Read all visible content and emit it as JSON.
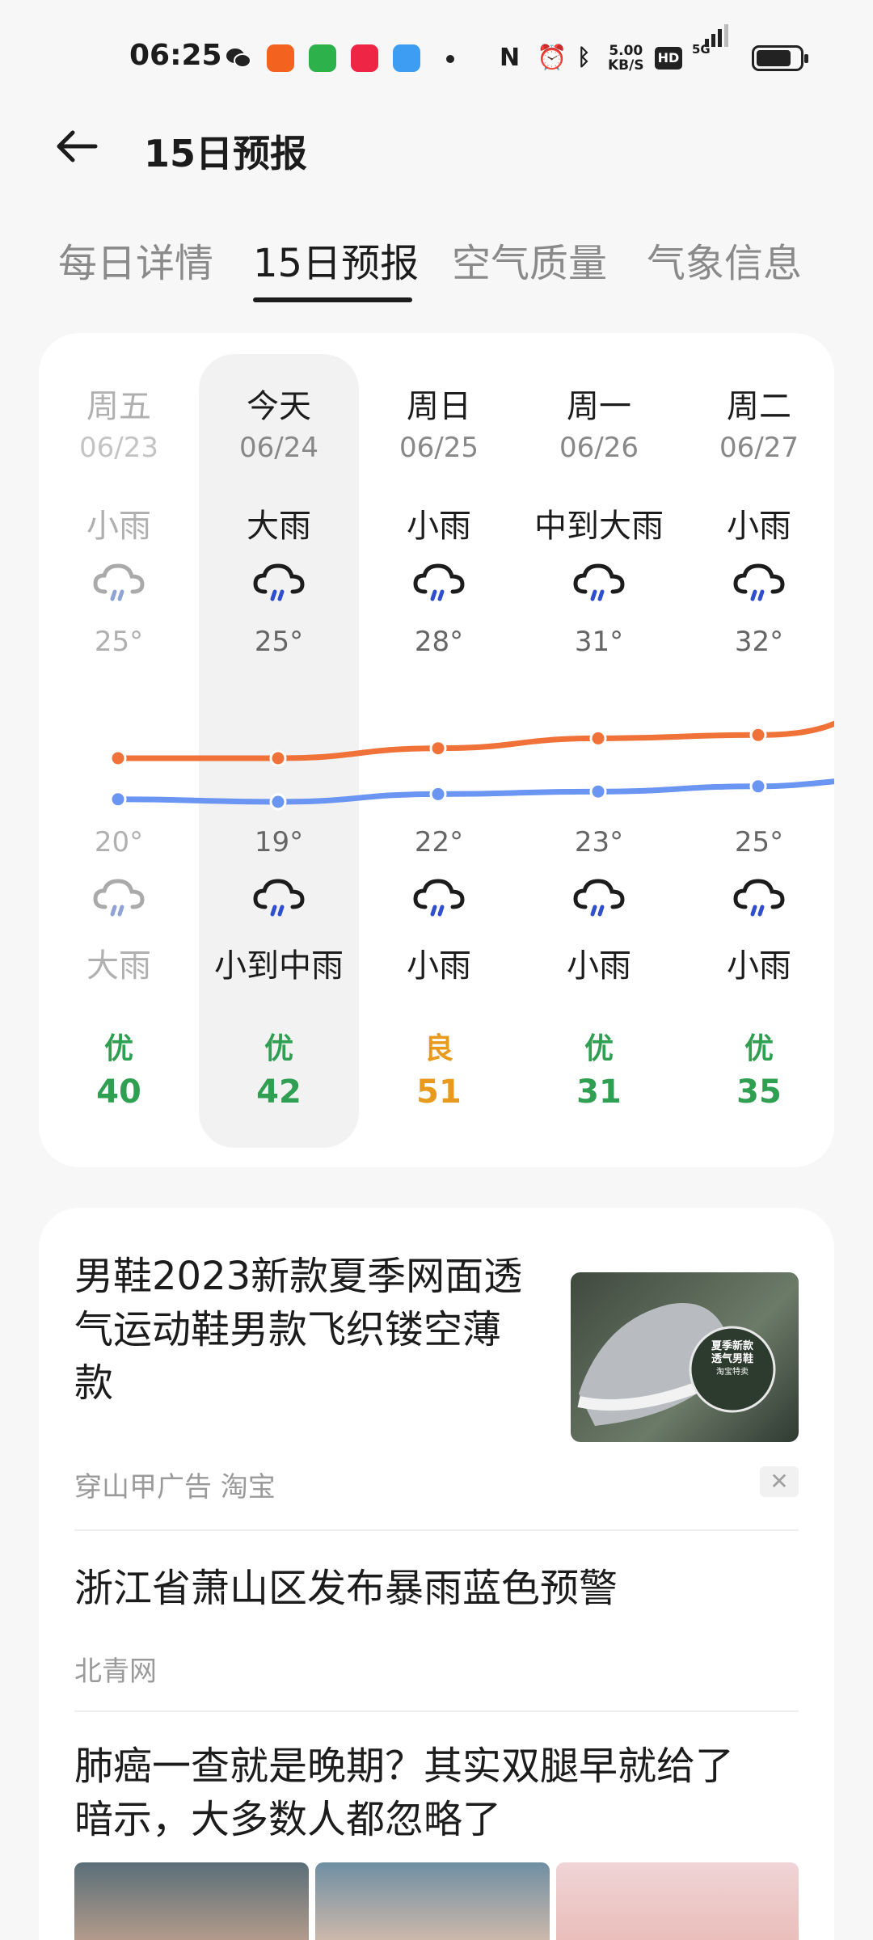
{
  "status_bar": {
    "time": "06:25",
    "net_speed_value": "5.00",
    "net_speed_unit": "KB/S",
    "hd": "HD",
    "network": "5G",
    "icons": [
      "wechat-icon",
      "kuaishou-icon",
      "wechat-mini-icon",
      "xiaohongshu-icon",
      "weather-icon",
      "nfc-icon",
      "alarm-icon",
      "bluetooth-icon",
      "signal-icon",
      "battery-icon"
    ]
  },
  "header": {
    "title": "15日预报"
  },
  "tabs": [
    {
      "label": "每日详情",
      "active": false
    },
    {
      "label": "15日预报",
      "active": true
    },
    {
      "label": "空气质量",
      "active": false
    },
    {
      "label": "气象信息",
      "active": false
    }
  ],
  "forecast": {
    "days": [
      {
        "day": "周五",
        "date": "06/23",
        "day_cond": "小雨",
        "high": "25°",
        "low": "20°",
        "night_cond": "大雨",
        "aqi_level": "优",
        "aqi": "40",
        "past": true
      },
      {
        "day": "今天",
        "date": "06/24",
        "day_cond": "大雨",
        "high": "25°",
        "low": "19°",
        "night_cond": "小到中雨",
        "aqi_level": "优",
        "aqi": "42",
        "today": true
      },
      {
        "day": "周日",
        "date": "06/25",
        "day_cond": "小雨",
        "high": "28°",
        "low": "22°",
        "night_cond": "小雨",
        "aqi_level": "良",
        "aqi": "51"
      },
      {
        "day": "周一",
        "date": "06/26",
        "day_cond": "中到大雨",
        "high": "31°",
        "low": "23°",
        "night_cond": "小雨",
        "aqi_level": "优",
        "aqi": "31"
      },
      {
        "day": "周二",
        "date": "06/27",
        "day_cond": "小雨",
        "high": "32°",
        "low": "25°",
        "night_cond": "小雨",
        "aqi_level": "优",
        "aqi": "35"
      }
    ],
    "colors": {
      "high_line": "#f07238",
      "low_line": "#6b95f2",
      "aqi_good": "#2f9f52",
      "aqi_moderate": "#e89a1d"
    },
    "weather_icon": "rain-cloud-icon"
  },
  "news": [
    {
      "title_lines": [
        "男鞋2023新款夏季网面透",
        "气运动鞋男款飞织镂空薄",
        "款"
      ],
      "source": "穿山甲广告  淘宝",
      "ad": true,
      "image_text": [
        "夏季新款",
        "透气男鞋",
        "淘宝特卖"
      ]
    },
    {
      "title_lines": [
        "浙江省萧山区发布暴雨蓝色预警"
      ],
      "source": "北青网"
    },
    {
      "title_lines": [
        "肺癌一查就是晚期？其实双腿早就给了",
        "暗示，大多数人都忽略了"
      ]
    }
  ]
}
